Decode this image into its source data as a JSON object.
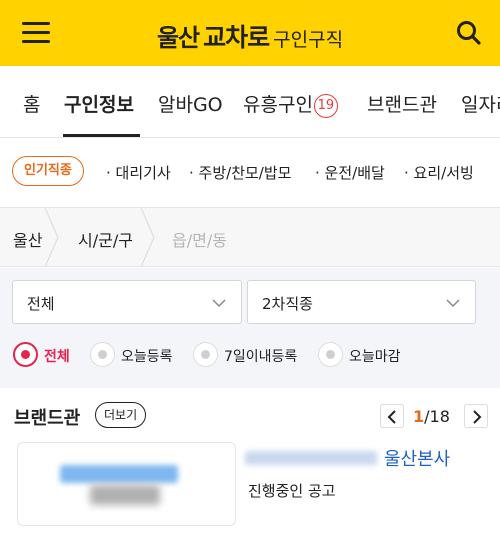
{
  "header": {
    "logo_region": "울산",
    "logo_brand": "교차로",
    "logo_service": "구인구직",
    "menu_icon": "hamburger-menu-icon",
    "search_icon": "search-icon",
    "background_color": "#ffd200"
  },
  "nav": {
    "items": [
      {
        "label": "홈"
      },
      {
        "label": "구인정보"
      },
      {
        "label": "알바GO"
      },
      {
        "label": "유흥구인"
      },
      {
        "label": "브랜드관"
      },
      {
        "label": "일자리"
      }
    ],
    "adult_badge": "19",
    "active_index": 1
  },
  "categories": {
    "popular_label": "인기직종",
    "items": [
      "대리기사",
      "주방/찬모/밥모",
      "운전/배달",
      "요리/서빙"
    ],
    "accent_color": "#e36b1a"
  },
  "region": {
    "steps": [
      "울산",
      "시/군/구",
      "읍/면/동"
    ]
  },
  "filters": {
    "primary_select": "전체",
    "secondary_select": "2차직종",
    "radios": [
      "전체",
      "오늘등록",
      "7일이내등록",
      "오늘마감"
    ],
    "active_radio": 0,
    "accent_color": "#e5244e"
  },
  "brand": {
    "title": "브랜드관",
    "more_label": "더보기",
    "page_current": "1",
    "page_total": "/18",
    "branch_name": "울산본사",
    "status": "진행중인 공고"
  }
}
